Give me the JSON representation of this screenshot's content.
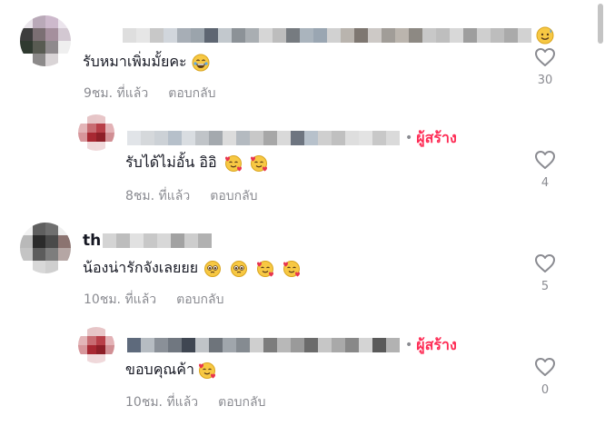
{
  "comments": [
    {
      "username_visible": "",
      "name_suffix_emoji": "sweat-smile-emoji",
      "text": "รับหมาเพิ่มมั้ยคะ",
      "emojis": [
        "laughing-emoji"
      ],
      "time": "9ชม. ที่แล้ว",
      "reply_label": "ตอบกลับ",
      "likes": "30",
      "is_creator": false
    },
    {
      "username_visible": "",
      "creator_label": "ผู้สร้าง",
      "text": "รับได้ไม่อั้น อิอิ",
      "emojis": [
        "smiling-hearts-emoji",
        "smiling-hearts-emoji"
      ],
      "time": "8ชม. ที่แล้ว",
      "reply_label": "ตอบกลับ",
      "likes": "4",
      "is_creator": true
    },
    {
      "username_visible": "th",
      "text": "น้องน่ารักจังเลยยย",
      "emojis": [
        "pleading-face-emoji",
        "pleading-face-emoji",
        "smiling-hearts-emoji",
        "smiling-hearts-emoji"
      ],
      "time": "10ชม. ที่แล้ว",
      "reply_label": "ตอบกลับ",
      "likes": "5",
      "is_creator": false
    },
    {
      "username_visible": "",
      "creator_label": "ผู้สร้าง",
      "text": "ขอบคุณค้า",
      "emojis": [
        "smiling-hearts-emoji"
      ],
      "time": "10ชม. ที่แล้ว",
      "reply_label": "ตอบกลับ",
      "likes": "0",
      "is_creator": true
    }
  ],
  "icons": {
    "like": "heart-outline-icon"
  },
  "colors": {
    "creator": "#fe2c55",
    "meta": "#8a8b91",
    "text": "#161823"
  }
}
